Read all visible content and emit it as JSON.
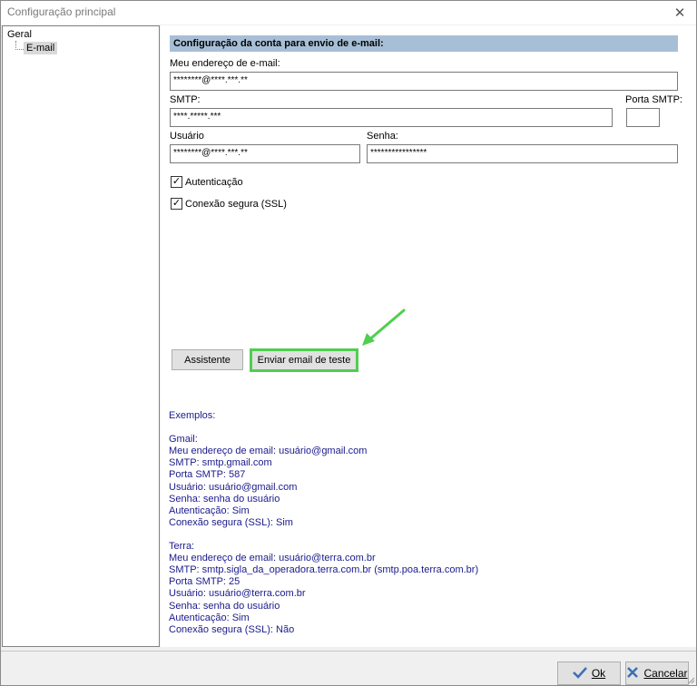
{
  "window": {
    "title": "Configuração principal",
    "close_glyph": "✕"
  },
  "tree": {
    "root": "Geral",
    "child": "E-mail"
  },
  "section": {
    "header": "Configuração da conta para envio de e-mail:"
  },
  "form": {
    "email_label": "Meu endereço de e-mail:",
    "email_value": "********@****.***.**",
    "smtp_label": "SMTP:",
    "smtp_value": "****.*****.***",
    "port_label": "Porta SMTP:",
    "port_value": "",
    "user_label": "Usuário",
    "user_value": "********@****.***.**",
    "password_label": "Senha:",
    "password_value": "****************",
    "auth_label": "Autenticação",
    "auth_checked": true,
    "ssl_label": "Conexão segura (SSL)",
    "ssl_checked": true
  },
  "buttons": {
    "assistant": "Assistente",
    "send_test": "Enviar email de teste",
    "ok": "Ok",
    "cancel": "Cancelar"
  },
  "examples": [
    "Exemplos:",
    "",
    "Gmail:",
    "Meu endereço de email: usuário@gmail.com",
    "SMTP: smtp.gmail.com",
    "Porta SMTP: 587",
    "Usuário: usuário@gmail.com",
    "Senha: senha do usuário",
    "Autenticação: Sim",
    "Conexão segura (SSL): Sim",
    "",
    "Terra:",
    "Meu endereço de email: usuário@terra.com.br",
    "SMTP: smtp.sigla_da_operadora.terra.com.br (smtp.poa.terra.com.br)",
    "Porta SMTP: 25",
    "Usuário: usuário@terra.com.br",
    "Senha: senha do usuário",
    "Autenticação: Sim",
    "Conexão segura (SSL): Não"
  ],
  "colors": {
    "highlight": "#4fcf4f",
    "header_bg": "#a7bfd6",
    "examples_text": "#1a1a8c"
  },
  "icons": {
    "ok": "checkmark-icon",
    "cancel": "x-mark-icon",
    "annotation": "green-arrow-icon"
  }
}
